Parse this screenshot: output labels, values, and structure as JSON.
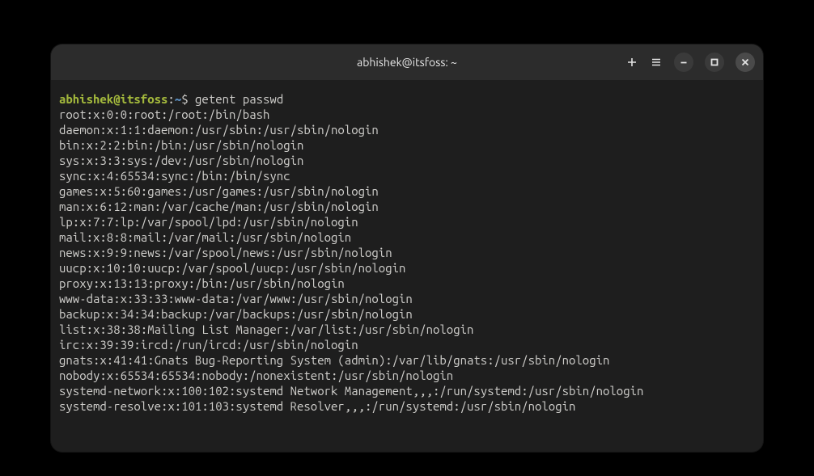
{
  "window": {
    "title": "abhishek@itsfoss: ~"
  },
  "prompt": {
    "user_host": "abhishek@itsfoss",
    "colon": ":",
    "path": "~",
    "symbol": "$",
    "command": " getent passwd"
  },
  "output": [
    "root:x:0:0:root:/root:/bin/bash",
    "daemon:x:1:1:daemon:/usr/sbin:/usr/sbin/nologin",
    "bin:x:2:2:bin:/bin:/usr/sbin/nologin",
    "sys:x:3:3:sys:/dev:/usr/sbin/nologin",
    "sync:x:4:65534:sync:/bin:/bin/sync",
    "games:x:5:60:games:/usr/games:/usr/sbin/nologin",
    "man:x:6:12:man:/var/cache/man:/usr/sbin/nologin",
    "lp:x:7:7:lp:/var/spool/lpd:/usr/sbin/nologin",
    "mail:x:8:8:mail:/var/mail:/usr/sbin/nologin",
    "news:x:9:9:news:/var/spool/news:/usr/sbin/nologin",
    "uucp:x:10:10:uucp:/var/spool/uucp:/usr/sbin/nologin",
    "proxy:x:13:13:proxy:/bin:/usr/sbin/nologin",
    "www-data:x:33:33:www-data:/var/www:/usr/sbin/nologin",
    "backup:x:34:34:backup:/var/backups:/usr/sbin/nologin",
    "list:x:38:38:Mailing List Manager:/var/list:/usr/sbin/nologin",
    "irc:x:39:39:ircd:/run/ircd:/usr/sbin/nologin",
    "gnats:x:41:41:Gnats Bug-Reporting System (admin):/var/lib/gnats:/usr/sbin/nologin",
    "nobody:x:65534:65534:nobody:/nonexistent:/usr/sbin/nologin",
    "systemd-network:x:100:102:systemd Network Management,,,:/run/systemd:/usr/sbin/nologin",
    "systemd-resolve:x:101:103:systemd Resolver,,,:/run/systemd:/usr/sbin/nologin"
  ]
}
